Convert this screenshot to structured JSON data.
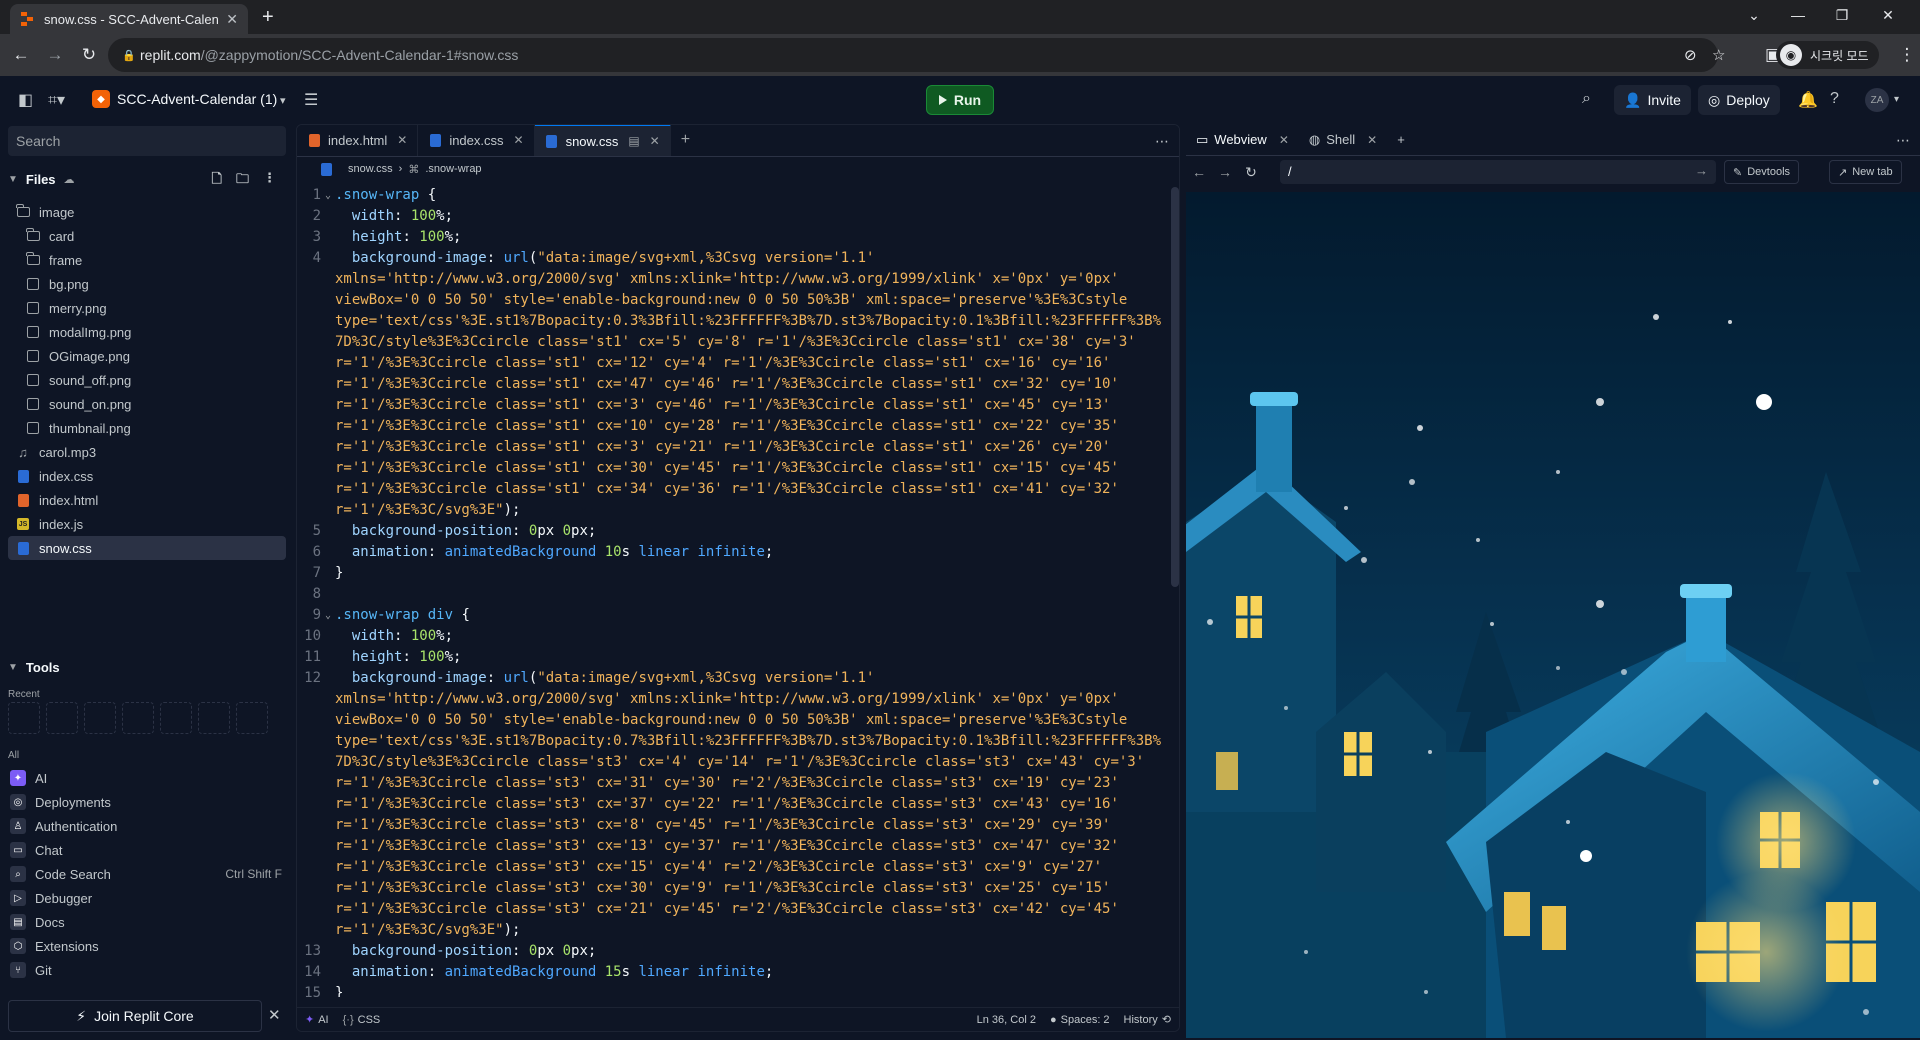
{
  "browser": {
    "tab_title": "snow.css - SCC-Advent-Calendar",
    "url_host": "replit.com",
    "url_path": "/@zappymotion/SCC-Advent-Calendar-1#snow.css",
    "incognito_label": "시크릿 모드"
  },
  "header": {
    "project_name": "SCC-Advent-Calendar (1)",
    "run_label": "Run",
    "invite_label": "Invite",
    "deploy_label": "Deploy",
    "avatar_initials": "ZA"
  },
  "sidebar": {
    "search_placeholder": "Search",
    "files_title": "Files",
    "tree": [
      {
        "name": "image",
        "type": "folder",
        "depth": 0
      },
      {
        "name": "card",
        "type": "folder",
        "depth": 1
      },
      {
        "name": "frame",
        "type": "folder",
        "depth": 1
      },
      {
        "name": "bg.png",
        "type": "image",
        "depth": 1
      },
      {
        "name": "merry.png",
        "type": "image",
        "depth": 1
      },
      {
        "name": "modalImg.png",
        "type": "image",
        "depth": 1
      },
      {
        "name": "OGimage.png",
        "type": "image",
        "depth": 1
      },
      {
        "name": "sound_off.png",
        "type": "image",
        "depth": 1
      },
      {
        "name": "sound_on.png",
        "type": "image",
        "depth": 1
      },
      {
        "name": "thumbnail.png",
        "type": "image",
        "depth": 1
      },
      {
        "name": "carol.mp3",
        "type": "audio",
        "depth": 0
      },
      {
        "name": "index.css",
        "type": "css",
        "depth": 0
      },
      {
        "name": "index.html",
        "type": "html",
        "depth": 0
      },
      {
        "name": "index.js",
        "type": "js",
        "depth": 0
      },
      {
        "name": "snow.css",
        "type": "css",
        "depth": 0,
        "selected": true
      }
    ],
    "tools_title": "Tools",
    "recent_label": "Recent",
    "all_label": "All",
    "tools": [
      {
        "name": "AI",
        "icon": "ai-icon",
        "color": "#7c5cf5",
        "shortcut": ""
      },
      {
        "name": "Deployments",
        "icon": "deployments-icon",
        "color": "#2b3245",
        "shortcut": ""
      },
      {
        "name": "Authentication",
        "icon": "user-icon",
        "color": "#2b3245",
        "shortcut": ""
      },
      {
        "name": "Chat",
        "icon": "chat-icon",
        "color": "#2b3245",
        "shortcut": ""
      },
      {
        "name": "Code Search",
        "icon": "search-icon",
        "color": "#2b3245",
        "shortcut": "Ctrl Shift F"
      },
      {
        "name": "Debugger",
        "icon": "debugger-icon",
        "color": "#2b3245",
        "shortcut": ""
      },
      {
        "name": "Docs",
        "icon": "docs-icon",
        "color": "#2b3245",
        "shortcut": ""
      },
      {
        "name": "Extensions",
        "icon": "extensions-icon",
        "color": "#2b3245",
        "shortcut": ""
      },
      {
        "name": "Git",
        "icon": "git-icon",
        "color": "#2b3245",
        "shortcut": ""
      }
    ],
    "join_label": "Join Replit Core"
  },
  "editor": {
    "tabs": [
      {
        "label": "index.html",
        "type": "html",
        "active": false
      },
      {
        "label": "index.css",
        "type": "css",
        "active": false
      },
      {
        "label": "snow.css",
        "type": "css",
        "active": true
      }
    ],
    "breadcrumb_file": "snow.css",
    "breadcrumb_symbol": ".snow-wrap",
    "lines": [
      {
        "n": "1",
        "fold": true,
        "text": ".snow-wrap {"
      },
      {
        "n": "2",
        "fold": false,
        "text": "  width: 100%;"
      },
      {
        "n": "3",
        "fold": false,
        "text": "  height: 100%;"
      },
      {
        "n": "4",
        "fold": false,
        "text": "  background-image: url(\"data:image/svg+xml,%3Csvg version='1.1'"
      },
      {
        "n": "",
        "fold": false,
        "text": "xmlns='http://www.w3.org/2000/svg' xmlns:xlink='http://www.w3.org/1999/xlink' x='0px' y='0px'"
      },
      {
        "n": "",
        "fold": false,
        "text": "viewBox='0 0 50 50' style='enable-background:new 0 0 50 50%3B' xml:space='preserve'%3E%3Cstyle"
      },
      {
        "n": "",
        "fold": false,
        "text": "type='text/css'%3E.st1%7Bopacity:0.3%3Bfill:%23FFFFFF%3B%7D.st3%7Bopacity:0.1%3Bfill:%23FFFFFF%3B%"
      },
      {
        "n": "",
        "fold": false,
        "text": "7D%3C/style%3E%3Ccircle class='st1' cx='5' cy='8' r='1'/%3E%3Ccircle class='st1' cx='38' cy='3'"
      },
      {
        "n": "",
        "fold": false,
        "text": "r='1'/%3E%3Ccircle class='st1' cx='12' cy='4' r='1'/%3E%3Ccircle class='st1' cx='16' cy='16'"
      },
      {
        "n": "",
        "fold": false,
        "text": "r='1'/%3E%3Ccircle class='st1' cx='47' cy='46' r='1'/%3E%3Ccircle class='st1' cx='32' cy='10'"
      },
      {
        "n": "",
        "fold": false,
        "text": "r='1'/%3E%3Ccircle class='st1' cx='3' cy='46' r='1'/%3E%3Ccircle class='st1' cx='45' cy='13'"
      },
      {
        "n": "",
        "fold": false,
        "text": "r='1'/%3E%3Ccircle class='st1' cx='10' cy='28' r='1'/%3E%3Ccircle class='st1' cx='22' cy='35'"
      },
      {
        "n": "",
        "fold": false,
        "text": "r='1'/%3E%3Ccircle class='st1' cx='3' cy='21' r='1'/%3E%3Ccircle class='st1' cx='26' cy='20'"
      },
      {
        "n": "",
        "fold": false,
        "text": "r='1'/%3E%3Ccircle class='st1' cx='30' cy='45' r='1'/%3E%3Ccircle class='st1' cx='15' cy='45'"
      },
      {
        "n": "",
        "fold": false,
        "text": "r='1'/%3E%3Ccircle class='st1' cx='34' cy='36' r='1'/%3E%3Ccircle class='st1' cx='41' cy='32'"
      },
      {
        "n": "",
        "fold": false,
        "text": "r='1'/%3E%3C/svg%3E\");"
      },
      {
        "n": "5",
        "fold": false,
        "text": "  background-position: 0px 0px;"
      },
      {
        "n": "6",
        "fold": false,
        "text": "  animation: animatedBackground 10s linear infinite;"
      },
      {
        "n": "7",
        "fold": false,
        "text": "}"
      },
      {
        "n": "8",
        "fold": false,
        "text": ""
      },
      {
        "n": "9",
        "fold": true,
        "text": ".snow-wrap div {"
      },
      {
        "n": "10",
        "fold": false,
        "text": "  width: 100%;"
      },
      {
        "n": "11",
        "fold": false,
        "text": "  height: 100%;"
      },
      {
        "n": "12",
        "fold": false,
        "text": "  background-image: url(\"data:image/svg+xml,%3Csvg version='1.1'"
      },
      {
        "n": "",
        "fold": false,
        "text": "xmlns='http://www.w3.org/2000/svg' xmlns:xlink='http://www.w3.org/1999/xlink' x='0px' y='0px'"
      },
      {
        "n": "",
        "fold": false,
        "text": "viewBox='0 0 50 50' style='enable-background:new 0 0 50 50%3B' xml:space='preserve'%3E%3Cstyle"
      },
      {
        "n": "",
        "fold": false,
        "text": "type='text/css'%3E.st1%7Bopacity:0.7%3Bfill:%23FFFFFF%3B%7D.st3%7Bopacity:0.1%3Bfill:%23FFFFFF%3B%"
      },
      {
        "n": "",
        "fold": false,
        "text": "7D%3C/style%3E%3Ccircle class='st3' cx='4' cy='14' r='1'/%3E%3Ccircle class='st3' cx='43' cy='3'"
      },
      {
        "n": "",
        "fold": false,
        "text": "r='1'/%3E%3Ccircle class='st3' cx='31' cy='30' r='2'/%3E%3Ccircle class='st3' cx='19' cy='23'"
      },
      {
        "n": "",
        "fold": false,
        "text": "r='1'/%3E%3Ccircle class='st3' cx='37' cy='22' r='1'/%3E%3Ccircle class='st3' cx='43' cy='16'"
      },
      {
        "n": "",
        "fold": false,
        "text": "r='1'/%3E%3Ccircle class='st3' cx='8' cy='45' r='1'/%3E%3Ccircle class='st3' cx='29' cy='39'"
      },
      {
        "n": "",
        "fold": false,
        "text": "r='1'/%3E%3Ccircle class='st3' cx='13' cy='37' r='1'/%3E%3Ccircle class='st3' cx='47' cy='32'"
      },
      {
        "n": "",
        "fold": false,
        "text": "r='1'/%3E%3Ccircle class='st3' cx='15' cy='4' r='2'/%3E%3Ccircle class='st3' cx='9' cy='27'"
      },
      {
        "n": "",
        "fold": false,
        "text": "r='1'/%3E%3Ccircle class='st3' cx='30' cy='9' r='1'/%3E%3Ccircle class='st3' cx='25' cy='15'"
      },
      {
        "n": "",
        "fold": false,
        "text": "r='1'/%3E%3Ccircle class='st3' cx='21' cy='45' r='2'/%3E%3Ccircle class='st3' cx='42' cy='45'"
      },
      {
        "n": "",
        "fold": false,
        "text": "r='1'/%3E%3C/svg%3E\");"
      },
      {
        "n": "13",
        "fold": false,
        "text": "  background-position: 0px 0px;"
      },
      {
        "n": "14",
        "fold": false,
        "text": "  animation: animatedBackground 15s linear infinite;"
      },
      {
        "n": "15",
        "fold": false,
        "text": "}"
      }
    ],
    "status": {
      "ai_label": "AI",
      "lang_label": "CSS",
      "cursor": "Ln 36, Col 2",
      "spaces": "Spaces: 2",
      "history": "History"
    }
  },
  "webview": {
    "tab_webview": "Webview",
    "tab_shell": "Shell",
    "url": "/",
    "devtools_label": "Devtools",
    "newtab_label": "New tab"
  },
  "colors": {
    "run_green": "#0f5a22",
    "accent_blue": "#0079f2",
    "scene_sky": "#0b2a45"
  }
}
